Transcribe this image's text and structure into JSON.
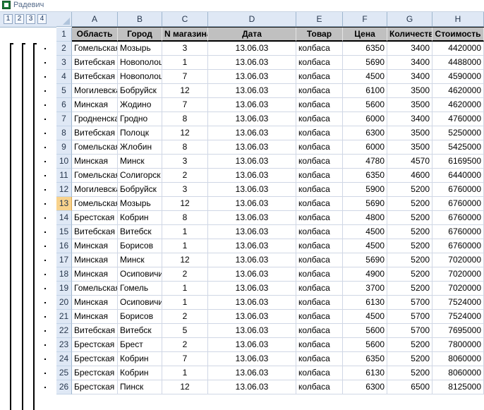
{
  "window": {
    "title": "Радевич"
  },
  "outline": {
    "levels": [
      "1",
      "2",
      "3",
      "4"
    ]
  },
  "columns": [
    "A",
    "B",
    "C",
    "D",
    "E",
    "F",
    "G",
    "H"
  ],
  "headers": [
    "Область",
    "Город",
    "N магазина",
    "Дата",
    "Товар",
    "Цена",
    "Количество",
    "Стоимость"
  ],
  "active_row": "13",
  "rows": [
    {
      "n": "2",
      "cells": [
        "Гомельская",
        "Мозырь",
        "3",
        "13.06.03",
        "колбаса",
        "6350",
        "3400",
        "4420000"
      ]
    },
    {
      "n": "3",
      "cells": [
        "Витебская",
        "Новополоцк",
        "1",
        "13.06.03",
        "колбаса",
        "5690",
        "3400",
        "4488000"
      ]
    },
    {
      "n": "4",
      "cells": [
        "Витебская",
        "Новополоцк",
        "7",
        "13.06.03",
        "колбаса",
        "4500",
        "3400",
        "4590000"
      ]
    },
    {
      "n": "5",
      "cells": [
        "Могилевская",
        "Бобруйск",
        "12",
        "13.06.03",
        "колбаса",
        "6100",
        "3500",
        "4620000"
      ]
    },
    {
      "n": "6",
      "cells": [
        "Минская",
        "Жодино",
        "7",
        "13.06.03",
        "колбаса",
        "5600",
        "3500",
        "4620000"
      ]
    },
    {
      "n": "7",
      "cells": [
        "Гродненская",
        "Гродно",
        "8",
        "13.06.03",
        "колбаса",
        "6000",
        "3400",
        "4760000"
      ]
    },
    {
      "n": "8",
      "cells": [
        "Витебская",
        "Полоцк",
        "12",
        "13.06.03",
        "колбаса",
        "6300",
        "3500",
        "5250000"
      ]
    },
    {
      "n": "9",
      "cells": [
        "Гомельская",
        "Жлобин",
        "8",
        "13.06.03",
        "колбаса",
        "6000",
        "3500",
        "5425000"
      ]
    },
    {
      "n": "10",
      "cells": [
        "Минская",
        "Минск",
        "3",
        "13.06.03",
        "колбаса",
        "4780",
        "4570",
        "6169500"
      ]
    },
    {
      "n": "11",
      "cells": [
        "Гомельская",
        "Солигорск",
        "2",
        "13.06.03",
        "колбаса",
        "6350",
        "4600",
        "6440000"
      ]
    },
    {
      "n": "12",
      "cells": [
        "Могилевская",
        "Бобруйск",
        "3",
        "13.06.03",
        "колбаса",
        "5900",
        "5200",
        "6760000"
      ]
    },
    {
      "n": "13",
      "cells": [
        "Гомельская",
        "Мозырь",
        "12",
        "13.06.03",
        "колбаса",
        "5690",
        "5200",
        "6760000"
      ]
    },
    {
      "n": "14",
      "cells": [
        "Брестская",
        "Кобрин",
        "8",
        "13.06.03",
        "колбаса",
        "4800",
        "5200",
        "6760000"
      ]
    },
    {
      "n": "15",
      "cells": [
        "Витебская",
        "Витебск",
        "1",
        "13.06.03",
        "колбаса",
        "4500",
        "5200",
        "6760000"
      ]
    },
    {
      "n": "16",
      "cells": [
        "Минская",
        "Борисов",
        "1",
        "13.06.03",
        "колбаса",
        "4500",
        "5200",
        "6760000"
      ]
    },
    {
      "n": "17",
      "cells": [
        "Минская",
        "Минск",
        "12",
        "13.06.03",
        "колбаса",
        "5690",
        "5200",
        "7020000"
      ]
    },
    {
      "n": "18",
      "cells": [
        "Минская",
        "Осиповичи",
        "2",
        "13.06.03",
        "колбаса",
        "4900",
        "5200",
        "7020000"
      ]
    },
    {
      "n": "19",
      "cells": [
        "Гомельская",
        "Гомель",
        "1",
        "13.06.03",
        "колбаса",
        "3700",
        "5200",
        "7020000"
      ]
    },
    {
      "n": "20",
      "cells": [
        "Минская",
        "Осиповичи",
        "1",
        "13.06.03",
        "колбаса",
        "6130",
        "5700",
        "7524000"
      ]
    },
    {
      "n": "21",
      "cells": [
        "Минская",
        "Борисов",
        "2",
        "13.06.03",
        "колбаса",
        "4500",
        "5700",
        "7524000"
      ]
    },
    {
      "n": "22",
      "cells": [
        "Витебская",
        "Витебск",
        "5",
        "13.06.03",
        "колбаса",
        "5600",
        "5700",
        "7695000"
      ]
    },
    {
      "n": "23",
      "cells": [
        "Брестская",
        "Брест",
        "2",
        "13.06.03",
        "колбаса",
        "5600",
        "5200",
        "7800000"
      ]
    },
    {
      "n": "24",
      "cells": [
        "Брестская",
        "Кобрин",
        "7",
        "13.06.03",
        "колбаса",
        "6350",
        "5200",
        "8060000"
      ]
    },
    {
      "n": "25",
      "cells": [
        "Брестская",
        "Кобрин",
        "1",
        "13.06.03",
        "колбаса",
        "6130",
        "5200",
        "8060000"
      ]
    },
    {
      "n": "26",
      "cells": [
        "Брестская",
        "Пинск",
        "12",
        "13.06.03",
        "колбаса",
        "6300",
        "6500",
        "8125000"
      ]
    }
  ]
}
